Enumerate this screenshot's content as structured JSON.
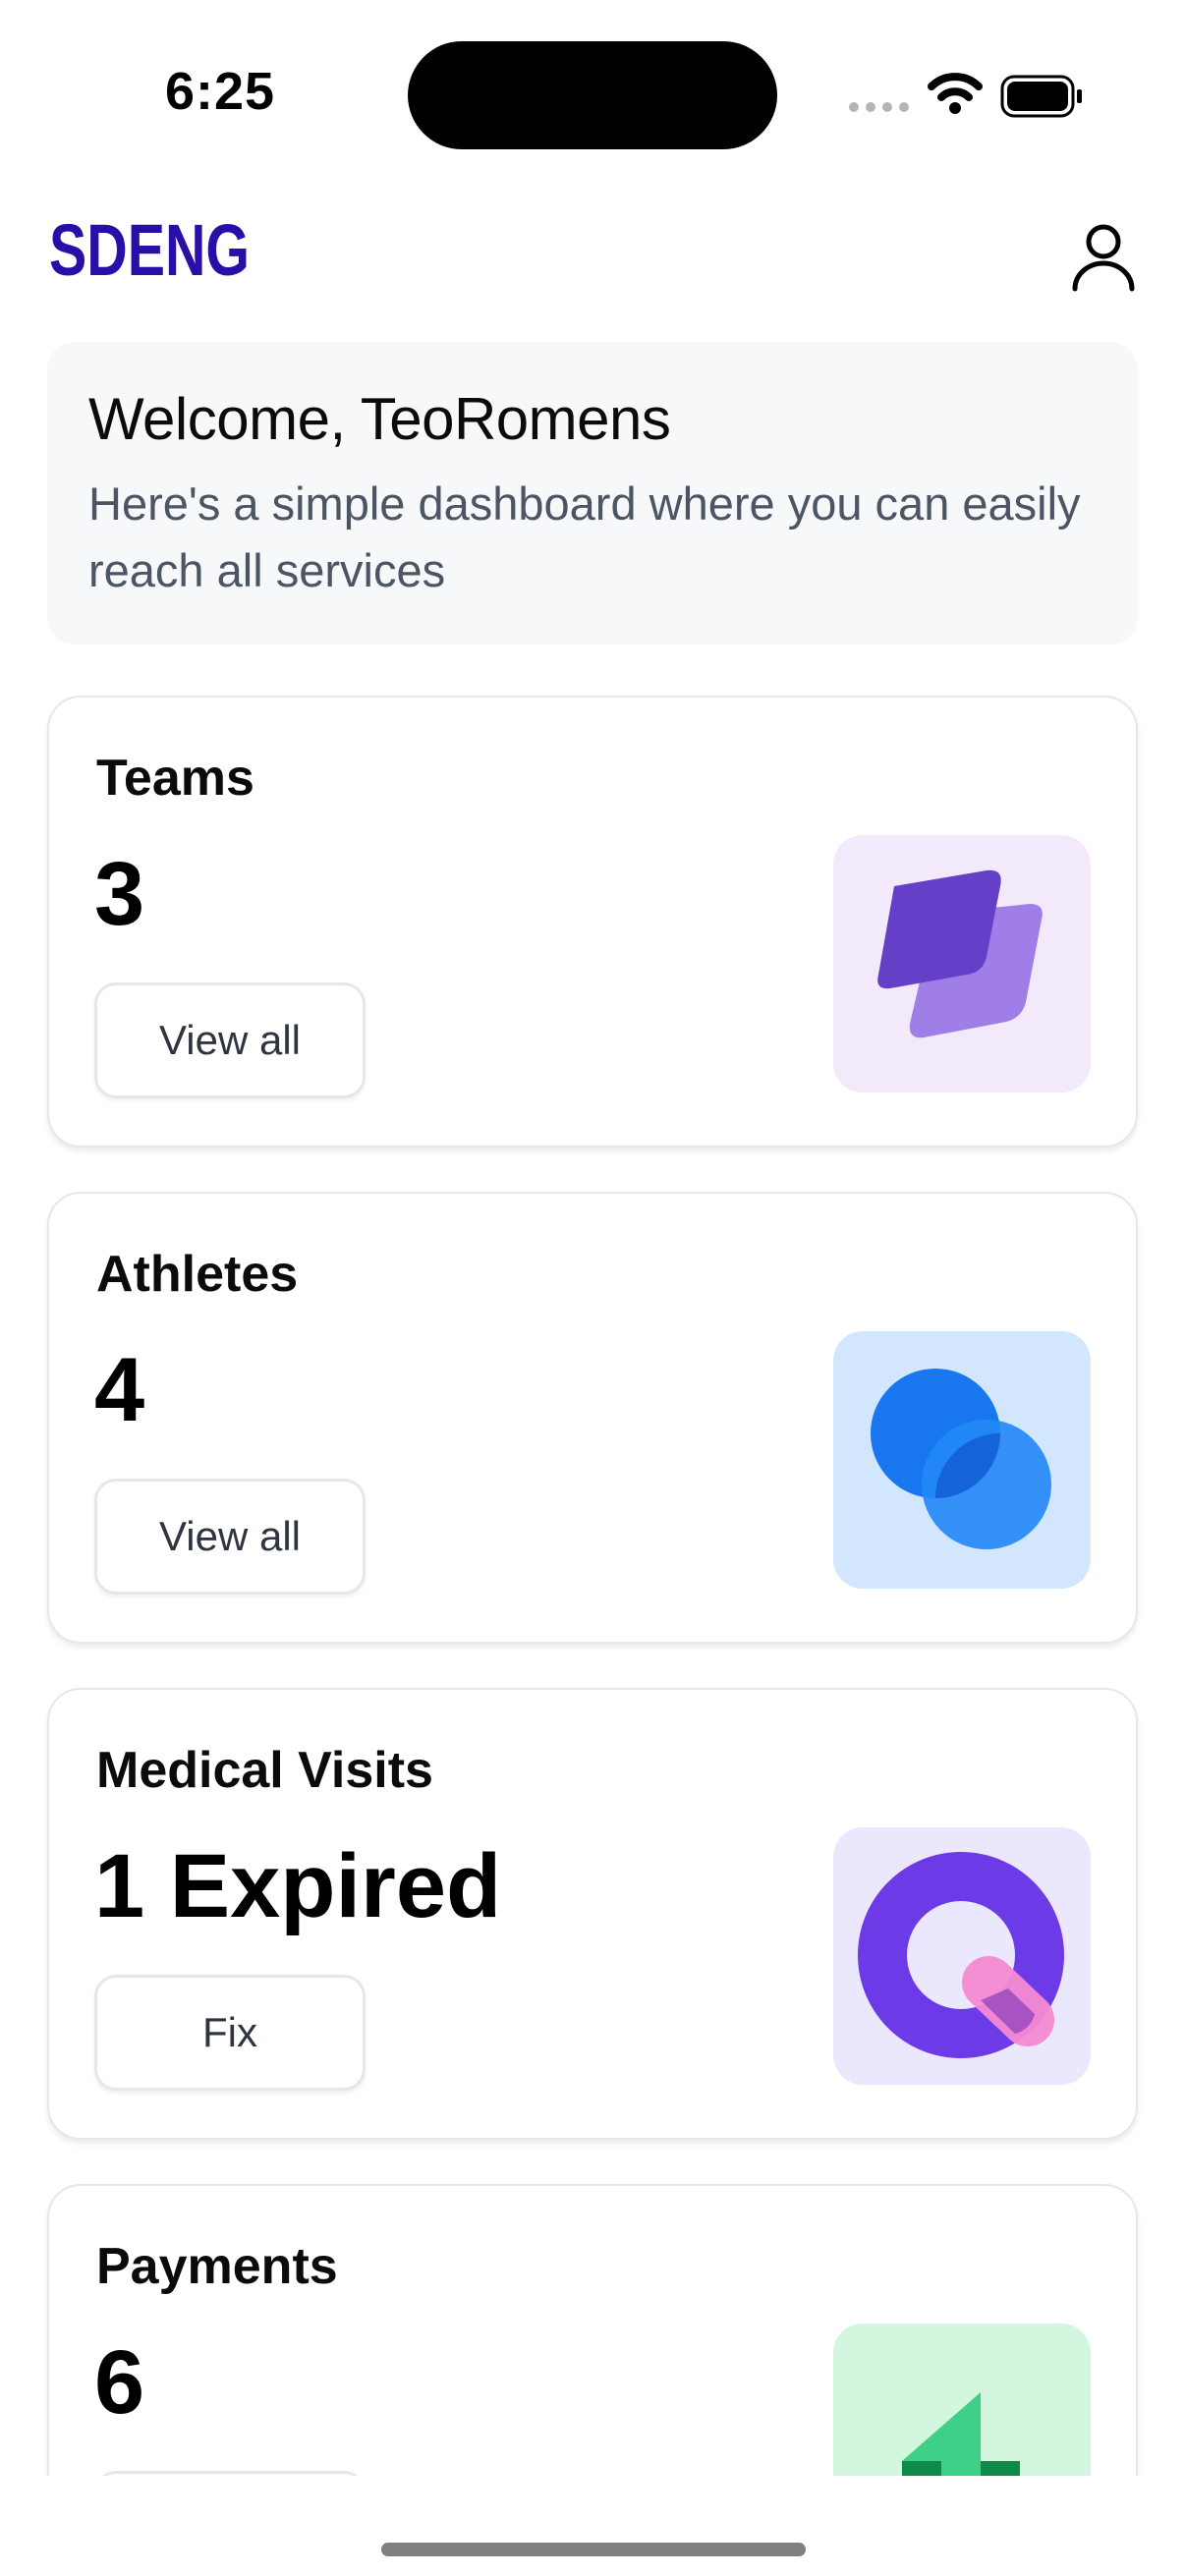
{
  "status_bar": {
    "time": "6:25"
  },
  "app": {
    "logo_text": "SDENG",
    "brand_color": "#2a0ea8"
  },
  "welcome": {
    "title": "Welcome, TeoRomens",
    "subtitle": "Here's a simple dashboard where you can easily reach all services"
  },
  "cards": [
    {
      "title": "Teams",
      "value": "3",
      "button": "View all",
      "icon": "teams-layers-icon",
      "bg": "#f2e9fb"
    },
    {
      "title": "Athletes",
      "value": "4",
      "button": "View all",
      "icon": "athletes-circles-icon",
      "bg": "#d2e6fd"
    },
    {
      "title": "Medical Visits",
      "value": "1 Expired",
      "button": "Fix",
      "icon": "medical-visits-icon",
      "bg": "#ebe8fd"
    },
    {
      "title": "Payments",
      "value": "6",
      "button": "",
      "icon": "payments-chart-icon",
      "bg": "#d2f6de"
    }
  ]
}
